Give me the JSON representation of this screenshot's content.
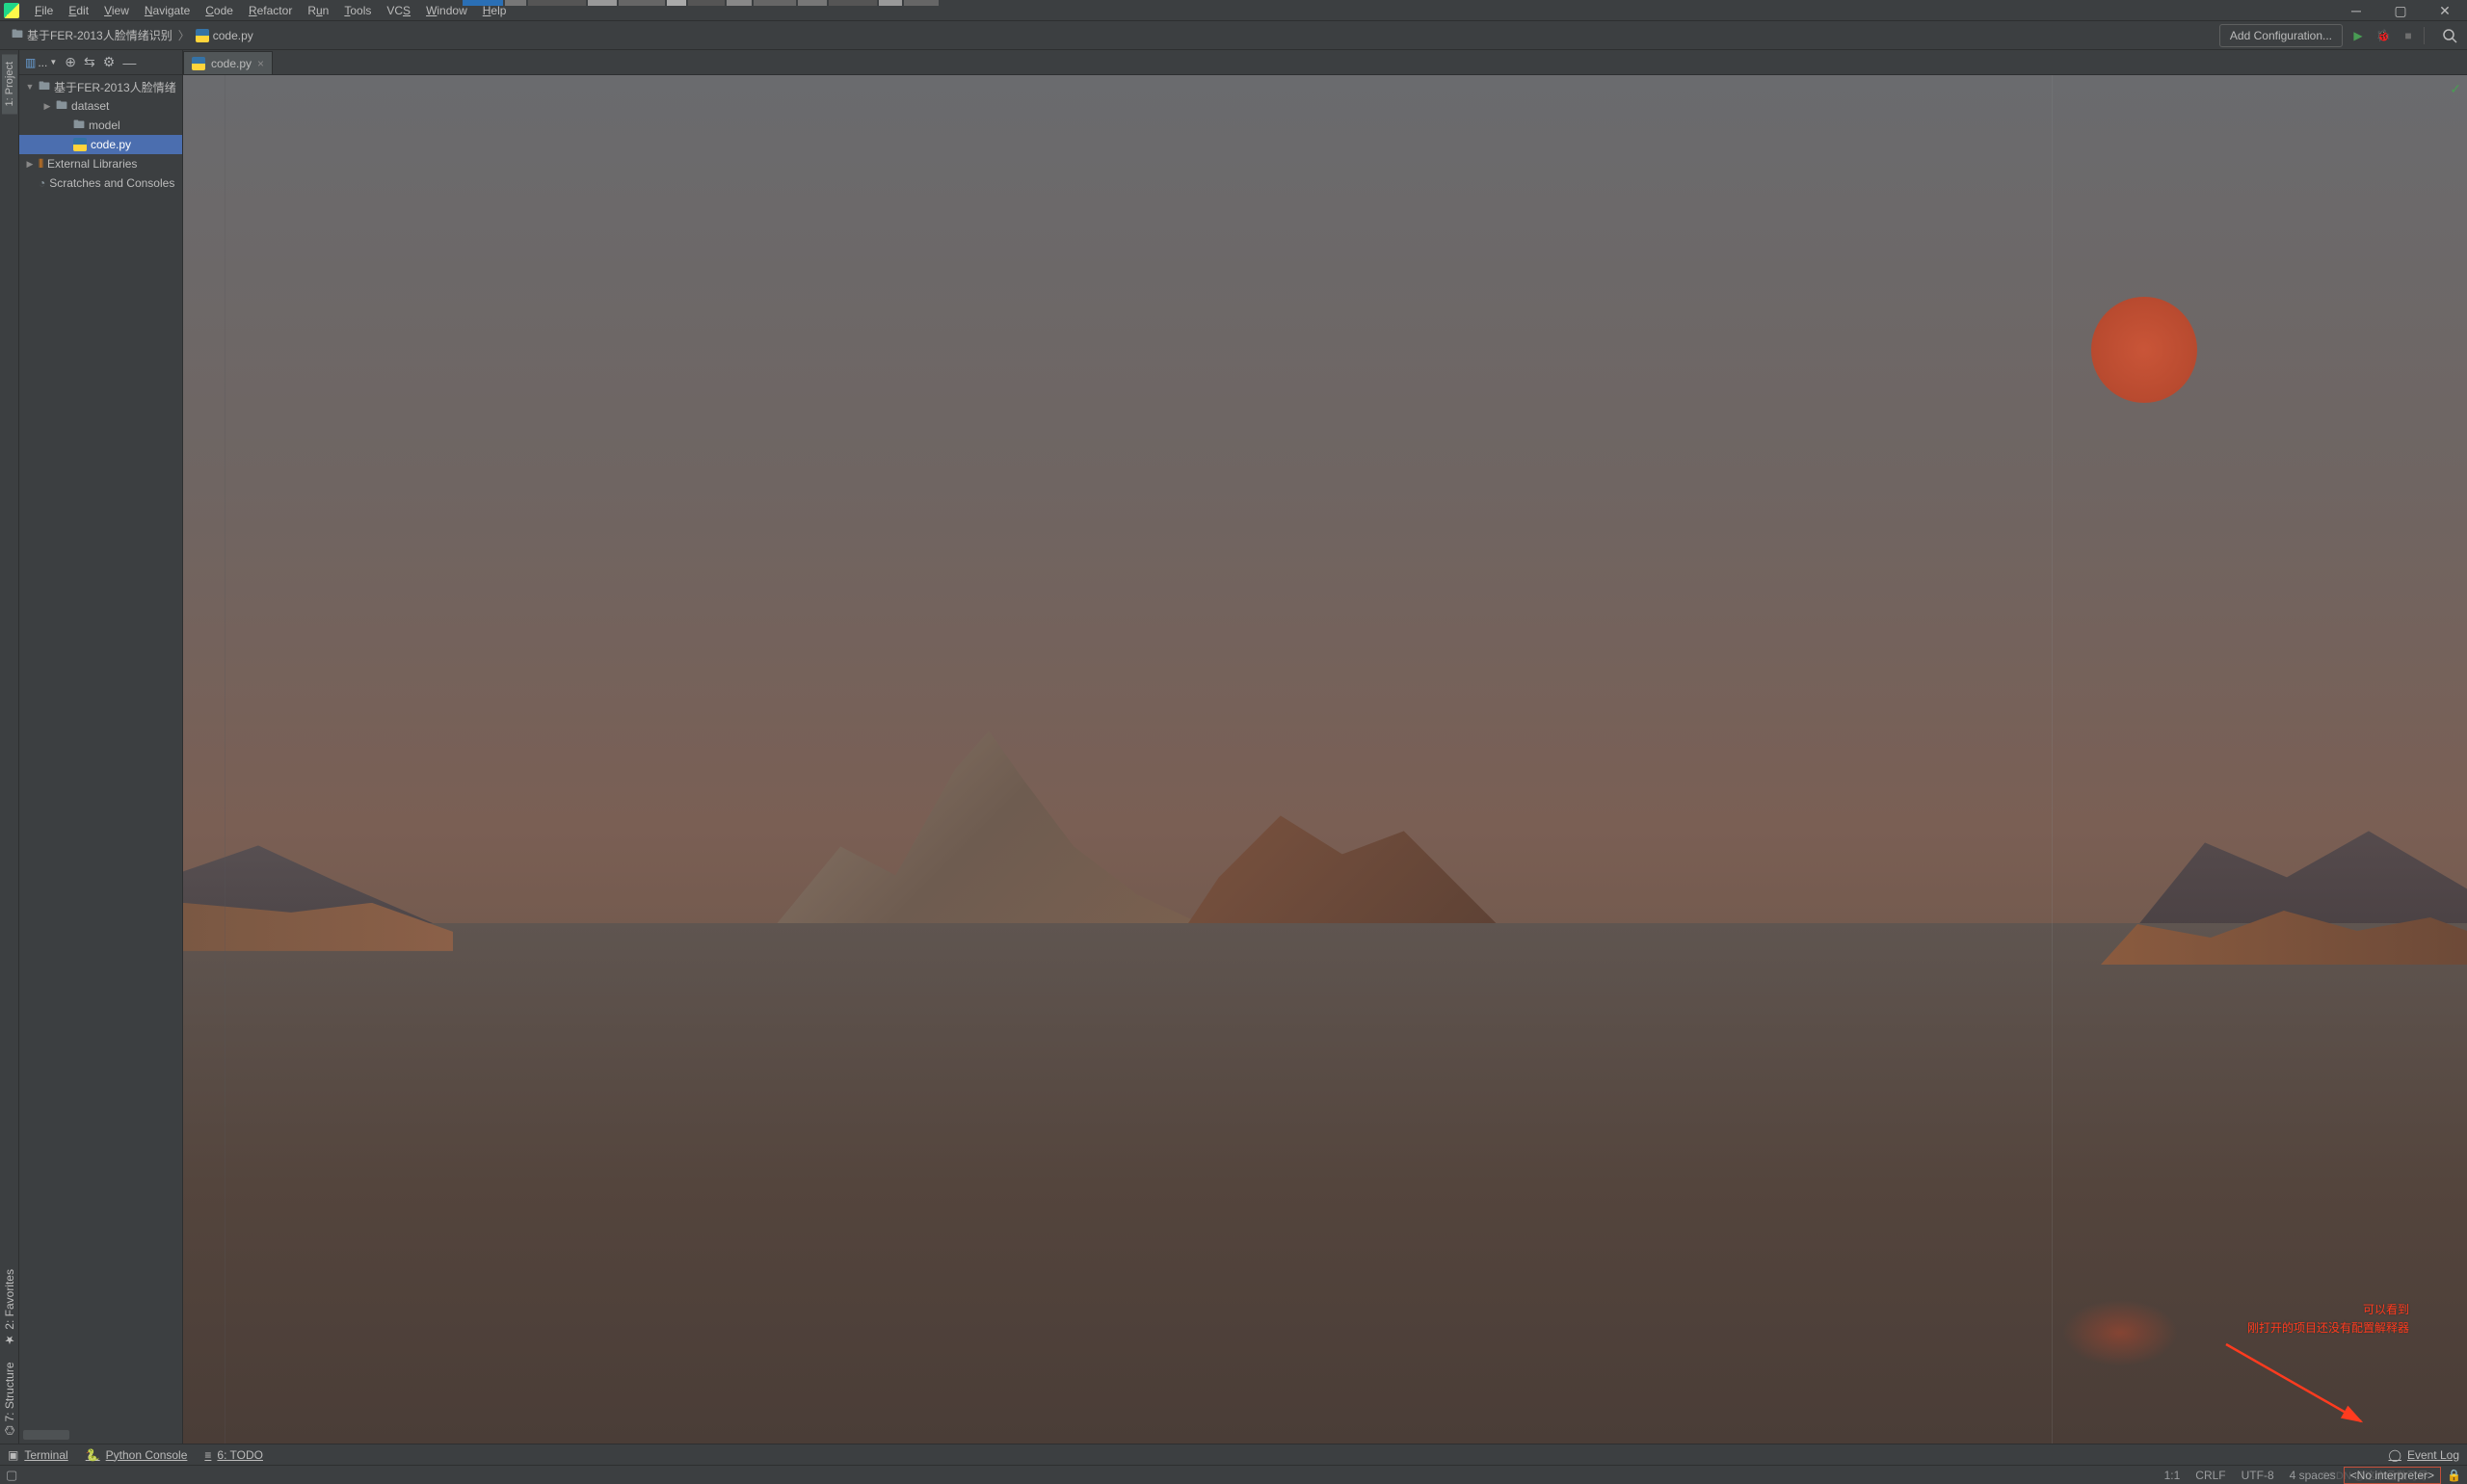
{
  "menubar": {
    "items": [
      "File",
      "Edit",
      "View",
      "Navigate",
      "Code",
      "Refactor",
      "Run",
      "Tools",
      "VCS",
      "Window",
      "Help"
    ]
  },
  "nav": {
    "project_crumb": "基于FER-2013人脸情绪识别",
    "file_crumb": "code.py",
    "config_button": "Add Configuration..."
  },
  "left_stripe": {
    "project": "1: Project",
    "favorites": "2: Favorites",
    "structure": "7: Structure"
  },
  "project_panel": {
    "dropdown": "...",
    "root": "基于FER-2013人脸情绪",
    "dataset": "dataset",
    "model": "model",
    "codepy": "code.py",
    "extlib": "External Libraries",
    "scratch": "Scratches and Consoles"
  },
  "editor": {
    "tab": "code.py"
  },
  "annotation": {
    "line1": "可以看到",
    "line2": "刚打开的项目还没有配置解释器"
  },
  "bottom_tools": {
    "terminal": "Terminal",
    "pyconsole": "Python Console",
    "todo": "6: TODO",
    "eventlog": "Event Log"
  },
  "statusbar": {
    "pos": "1:1",
    "eol": "CRLF",
    "enc": "UTF-8",
    "indent": "4 spaces",
    "interp": "<No interpreter>",
    "watermark": "CSDN @这个函数可导"
  }
}
